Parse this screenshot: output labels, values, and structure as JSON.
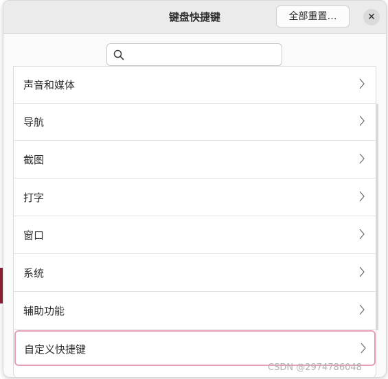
{
  "dialog": {
    "title": "键盘快捷键",
    "reset_label": "全部重置…",
    "close_symbol": "✕"
  },
  "search": {
    "placeholder": "",
    "value": ""
  },
  "categories": [
    {
      "label": "声音和媒体"
    },
    {
      "label": "导航"
    },
    {
      "label": "截图"
    },
    {
      "label": "打字"
    },
    {
      "label": "窗口"
    },
    {
      "label": "系统"
    },
    {
      "label": "辅助功能"
    },
    {
      "label": "自定义快捷键"
    }
  ],
  "watermark": "CSDN @2974786048",
  "icons": {
    "search": "search-icon",
    "chevron": "chevron-right-icon",
    "close": "close-icon"
  },
  "colors": {
    "focus_border": "#e6a0b4",
    "accent": "#8d2136"
  }
}
